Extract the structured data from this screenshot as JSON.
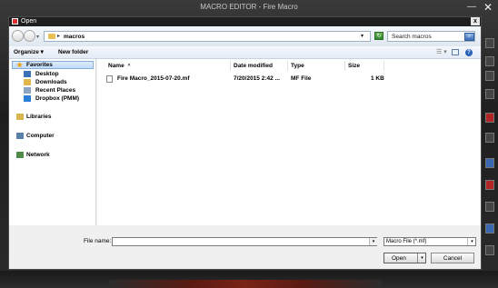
{
  "app": {
    "title": "MACRO EDITOR - Fire Macro",
    "minimize": "—",
    "close": "✕"
  },
  "dialog": {
    "title": "Open",
    "close": "x"
  },
  "nav": {
    "path": "macros",
    "path_arrow": "▸",
    "address_dropdown": "▾",
    "search_placeholder": "Search macros",
    "search_glyph": "⌕",
    "refresh_glyph": "↻"
  },
  "toolbar": {
    "organize": "Organize ▾",
    "new_folder": "New folder",
    "views_glyph": "☰ ▾",
    "help_glyph": "?"
  },
  "sidebar": {
    "items": [
      {
        "label": "Favorites",
        "icon": "star-icon"
      },
      {
        "label": "Desktop",
        "icon": "desktop-icon"
      },
      {
        "label": "Downloads",
        "icon": "downloads-icon"
      },
      {
        "label": "Recent Places",
        "icon": "recent-places-icon"
      },
      {
        "label": "Dropbox (PMM)",
        "icon": "dropbox-icon"
      },
      {
        "label": "Libraries",
        "icon": "libraries-icon"
      },
      {
        "label": "Computer",
        "icon": "computer-icon"
      },
      {
        "label": "Network",
        "icon": "network-icon"
      }
    ]
  },
  "filelist": {
    "columns": [
      "Name",
      "Date modified",
      "Type",
      "Size"
    ],
    "sort_arrow": "^",
    "rows": [
      {
        "name": "Fire Macro_2015-07-20.mf",
        "date": "7/20/2015 2:42 ...",
        "type": "MF File",
        "size": "1 KB"
      }
    ]
  },
  "bottom": {
    "file_name_label": "File name:",
    "file_name_value": "",
    "file_type": "Macro File (*.mf)",
    "dropdown_glyph": "▾",
    "open_label": "Open",
    "cancel_label": "Cancel"
  },
  "colors": {
    "accent": "#3768b0",
    "app_bg": "#1e1e1e",
    "dialog_bg": "#f0f0f0"
  }
}
